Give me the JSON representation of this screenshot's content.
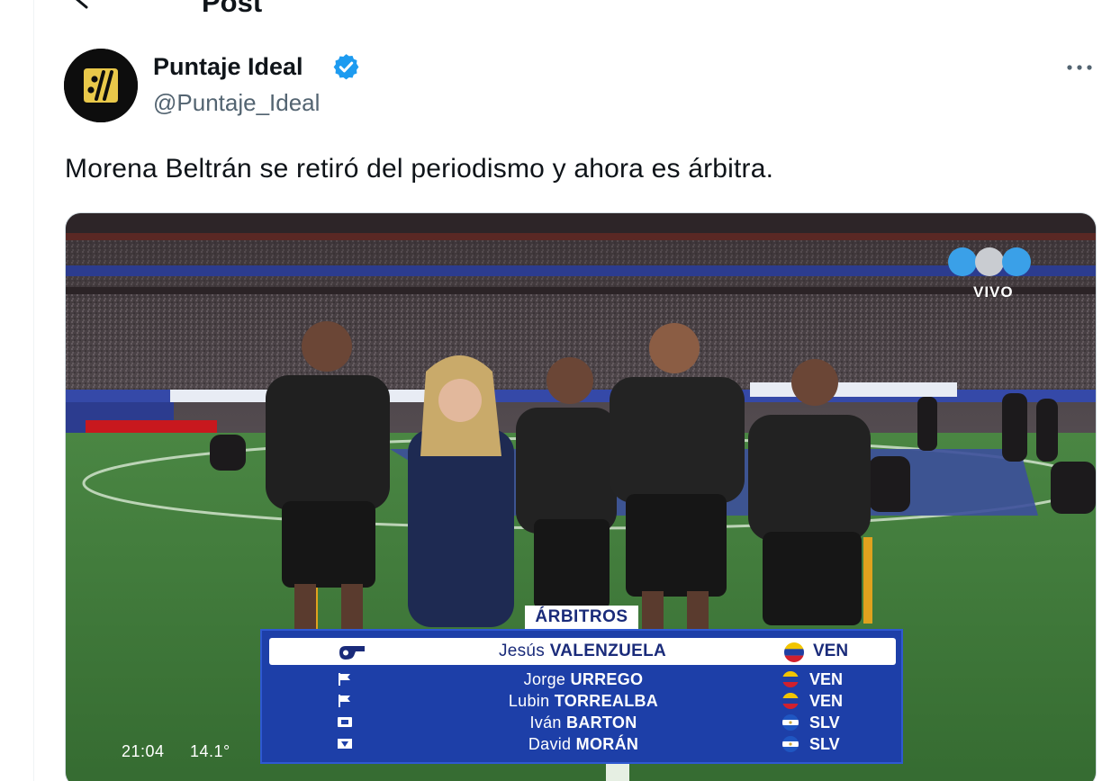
{
  "header": {
    "title": "Post"
  },
  "author": {
    "display_name": "Puntaje Ideal",
    "handle": "@Puntaje_Ideal",
    "avatar_icon": "puntaje-ideal-logo",
    "verified_icon": "verified-badge-icon",
    "verified_color": "#1d9bf0"
  },
  "tweet": {
    "text": "Morena Beltrán se retiró del periodismo y ahora es árbitra."
  },
  "media": {
    "live_label": "VIVO",
    "time": "21:04",
    "temperature": "14.1°",
    "referees_title": "ÁRBITROS",
    "referees": [
      {
        "role_icon": "whistle-icon",
        "first": "Jesús",
        "last": "VALENZUELA",
        "country": "VEN",
        "flag": "venezuela-flag"
      },
      {
        "role_icon": "flag-icon",
        "first": "Jorge",
        "last": "URREGO",
        "country": "VEN",
        "flag": "venezuela-flag"
      },
      {
        "role_icon": "flag-icon",
        "first": "Lubin",
        "last": "TORREALBA",
        "country": "VEN",
        "flag": "venezuela-flag"
      },
      {
        "role_icon": "board-icon",
        "first": "Iván",
        "last": "BARTON",
        "country": "SLV",
        "flag": "el-salvador-flag"
      },
      {
        "role_icon": "var-icon",
        "first": "David",
        "last": "MORÁN",
        "country": "SLV",
        "flag": "el-salvador-flag"
      }
    ],
    "colors": {
      "panel": "#1d3fa8",
      "title_text": "#1a2b7a",
      "pitch": "#3f7a3a"
    }
  }
}
